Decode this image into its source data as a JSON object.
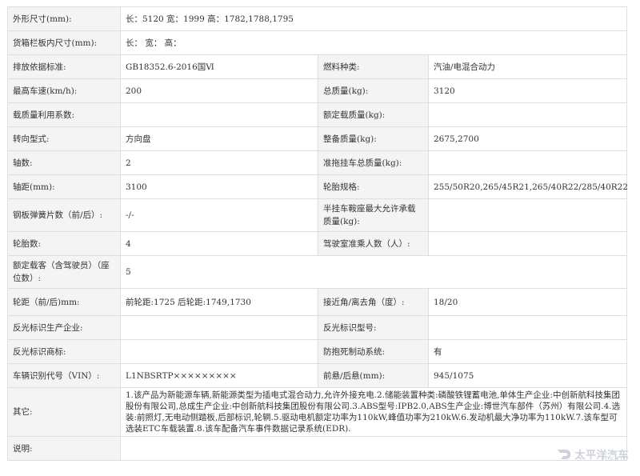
{
  "rows": [
    {
      "label": "外形尺寸(mm):",
      "value": "长：5120 宽：1999 高：1782,1788,1795"
    },
    {
      "label": "货箱栏板内尺寸(mm):",
      "value": "长：  宽：  高："
    },
    {
      "label": "排放依据标准:",
      "value": "GB18352.6-2016国Ⅵ",
      "label2": "燃料种类:",
      "value2": "汽油/电混合动力"
    },
    {
      "label": "最高车速(km/h):",
      "value": "200",
      "label2": "总质量(kg):",
      "value2": "3120"
    },
    {
      "label": "载质量利用系数:",
      "value": "",
      "label2": "额定载质量(kg):",
      "value2": ""
    },
    {
      "label": "转向型式:",
      "value": "方向盘",
      "label2": "整备质量(kg):",
      "value2": "2675,2700"
    },
    {
      "label": "轴数:",
      "value": "2",
      "label2": "准拖挂车总质量(kg):",
      "value2": ""
    },
    {
      "label": "轴距(mm):",
      "value": "3100",
      "label2": "轮胎规格:",
      "value2": "255/50R20,265/45R21,265/40R22/285/40R22"
    },
    {
      "label": "钢板弹簧片数（前/后）:",
      "value": "-/-",
      "label2": "半挂车鞍座最大允许承载质量(kg):",
      "value2": ""
    },
    {
      "label": "轮胎数:",
      "value": "4",
      "label2": "驾驶室准乘人数（人）:",
      "value2": ""
    },
    {
      "label": "额定载客（含驾驶员）（座位数）:",
      "value": "5"
    },
    {
      "label": "轮距（前/后)mm:",
      "value": "前轮距:1725 后轮距:1749,1730",
      "label2": "接近角/离去角（度）:",
      "value2": "18/20"
    },
    {
      "label": "反光标识生产企业:",
      "value": "",
      "label2": "反光标识型号:",
      "value2": ""
    },
    {
      "label": "反光标识商标:",
      "value": "",
      "label2": "防抱死制动系统:",
      "value2": "有"
    },
    {
      "label": "车辆识别代号（VIN）:",
      "value": "L1NBSRTP×××××××××",
      "label2": "前悬/后悬(mm):",
      "value2": "945/1075"
    },
    {
      "label": "其它:",
      "value": "1.该产品为新能源车辆,新能源类型为插电式混合动力,允许外接充电.2.储能装置种类:磷酸铁锂蓄电池,单体生产企业:中创新航科技集团股份有限公司,总成生产企业:中创新航科技集团股份有限公司.3.ABS型号:IPB2.0,ABS生产企业:博世汽车部件（苏州）有限公司.4.选装:前照灯,无电动侧踏板,后部标识,轮辋.5.驱动电机额定功率为110kW,峰值功率为210kW.6.发动机最大净功率为110kW.7.该车型可选装ETC车载装置.8.该车配备汽车事件数据记录系统(EDR)."
    },
    {
      "label": "说明:",
      "value": ""
    }
  ],
  "watermark": {
    "text": "太平洋汽车",
    "sub": "PCAUTO"
  }
}
